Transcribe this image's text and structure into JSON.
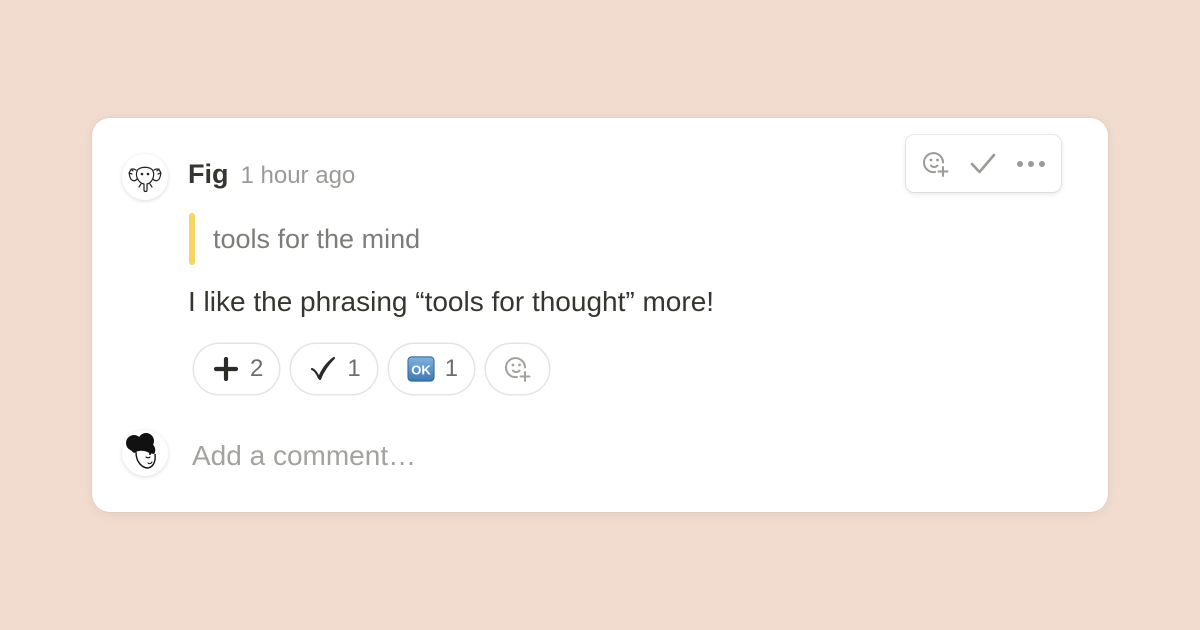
{
  "comment": {
    "author": "Fig",
    "timestamp": "1 hour ago",
    "quote": "tools for the mind",
    "body": "I like the phrasing “tools for thought” more!",
    "author_avatar_icon": "elephant-avatar-icon"
  },
  "toolbar": {
    "icons": [
      "add-reaction-icon",
      "resolve-check-icon",
      "more-options-icon"
    ]
  },
  "reactions": [
    {
      "icon": "plus-icon",
      "count": "2"
    },
    {
      "icon": "check-mark-icon",
      "count": "1"
    },
    {
      "icon": "ok-button-icon",
      "count": "1"
    }
  ],
  "add_reaction_icon": "add-reaction-icon",
  "reply": {
    "placeholder": "Add a comment…",
    "user_avatar_icon": "user-avatar-icon"
  },
  "colors": {
    "background": "#f1dccf",
    "card": "#ffffff",
    "quote_bar": "#f6d563",
    "text_primary": "#37352f",
    "text_muted": "#9b9a97"
  }
}
